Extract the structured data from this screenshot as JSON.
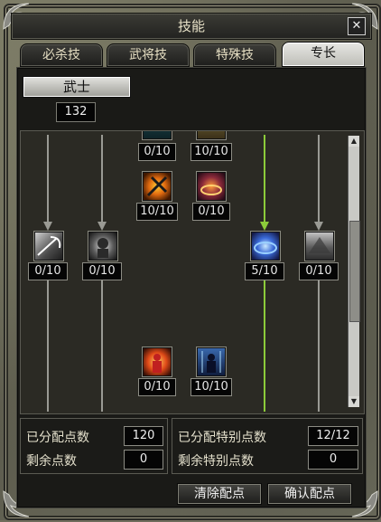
{
  "window": {
    "title": "技能",
    "close_glyph": "✕"
  },
  "tabs": [
    {
      "label": "必杀技",
      "active": false
    },
    {
      "label": "武将技",
      "active": false
    },
    {
      "label": "特殊技",
      "active": false
    },
    {
      "label": "专长",
      "active": true
    }
  ],
  "class_button": {
    "label": "武士"
  },
  "class_points": "132",
  "skills": [
    {
      "level": "0/10",
      "icon": "frost-rune-icon"
    },
    {
      "level": "10/10",
      "icon": "gold-emblem-icon"
    },
    {
      "level": "10/10",
      "icon": "crossed-blades-icon"
    },
    {
      "level": "0/10",
      "icon": "fire-ring-icon"
    },
    {
      "level": "0/10",
      "icon": "axe-strike-icon"
    },
    {
      "level": "0/10",
      "icon": "warrior-head-icon"
    },
    {
      "level": "5/10",
      "icon": "blue-vortex-icon"
    },
    {
      "level": "0/10",
      "icon": "storm-cloud-icon"
    },
    {
      "level": "0/10",
      "icon": "fire-aura-man-icon"
    },
    {
      "level": "10/10",
      "icon": "ice-aura-man-icon"
    }
  ],
  "stats": {
    "assigned_label": "已分配点数",
    "assigned_value": "120",
    "remaining_label": "剩余点数",
    "remaining_value": "0",
    "special_assigned_label": "已分配特别点数",
    "special_assigned_value": "12/12",
    "special_remaining_label": "剩余特别点数",
    "special_remaining_value": "0"
  },
  "buttons": {
    "clear": "清除配点",
    "confirm": "确认配点"
  },
  "colors": {
    "active_path": "#8ccc3a",
    "inactive_path": "#9a9a94"
  }
}
